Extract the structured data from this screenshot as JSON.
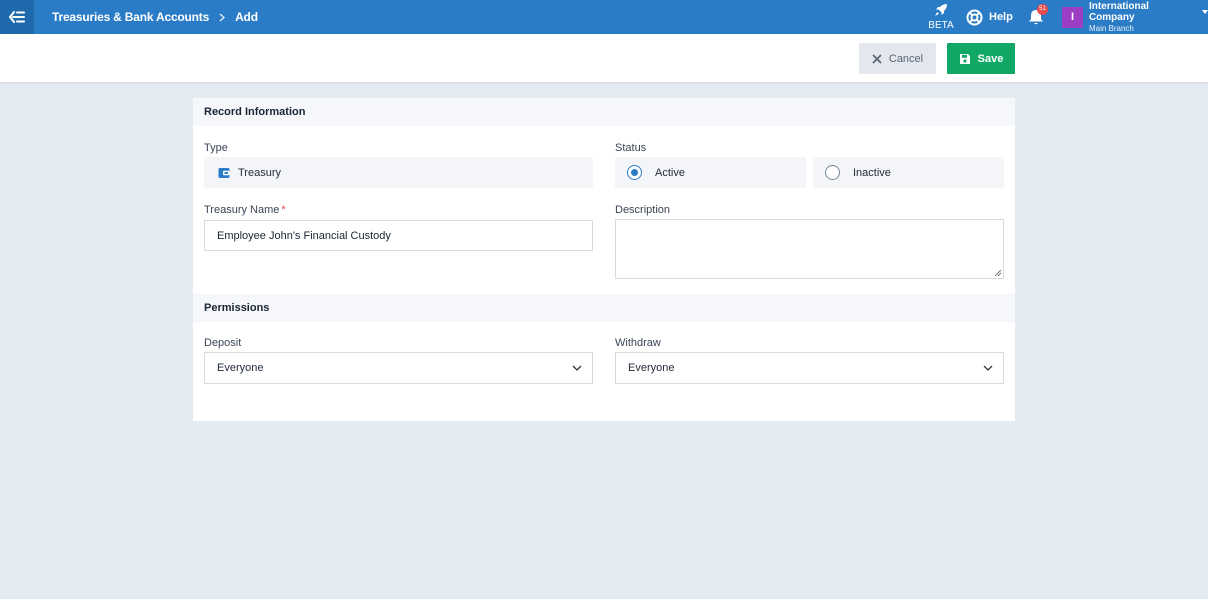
{
  "topbar": {
    "breadcrumb": [
      "Treasuries & Bank Accounts",
      "Add"
    ],
    "beta_label": "BETA",
    "help_label": "Help",
    "notification_count": "51",
    "company_initial": "I",
    "company_name": "International Company",
    "branch_name": "Main Branch",
    "colors": {
      "bar": "#2a7cc7",
      "avatar": "#9c3ec4",
      "badge": "#e84b4b"
    }
  },
  "actions": {
    "cancel_label": "Cancel",
    "save_label": "Save",
    "colors": {
      "save": "#11a866",
      "cancel": "#e4e8ee"
    }
  },
  "record_info": {
    "title": "Record Information",
    "type_label": "Type",
    "type_value": "Treasury",
    "type_icon": "wallet-icon",
    "status_label": "Status",
    "status_options": [
      "Active",
      "Inactive"
    ],
    "status_selected": "Active",
    "name_label": "Treasury Name",
    "name_required_mark": "*",
    "name_value": "Employee John's Financial Custody",
    "description_label": "Description",
    "description_value": ""
  },
  "permissions": {
    "title": "Permissions",
    "deposit_label": "Deposit",
    "deposit_value": "Everyone",
    "withdraw_label": "Withdraw",
    "withdraw_value": "Everyone"
  }
}
